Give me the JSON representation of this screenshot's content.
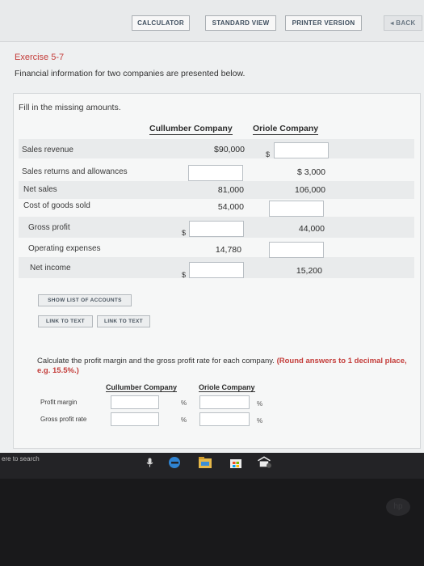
{
  "toolbar": {
    "calculator": "CALCULATOR",
    "standard_view": "STANDARD VIEW",
    "printer_version": "PRINTER VERSION",
    "back": "◂ BACK"
  },
  "exercise": {
    "title": "Exercise 5-7",
    "description": "Financial information for two companies are presented below."
  },
  "table": {
    "instruction": "Fill in the missing amounts.",
    "col1_header": "Cullumber Company",
    "col2_header": "Oriole Company",
    "dollar": "$",
    "rows": [
      {
        "label": "Sales revenue",
        "col1": "$90,000",
        "col2": ""
      },
      {
        "label": "Sales returns and allowances",
        "col1": "",
        "col2": "$ 3,000"
      },
      {
        "label": "Net sales",
        "col1": "81,000",
        "col2": "106,000"
      },
      {
        "label": "Cost of goods sold",
        "col1": "54,000",
        "col2": ""
      },
      {
        "label": "Gross profit",
        "col1": "",
        "col2": "44,000"
      },
      {
        "label": "Operating expenses",
        "col1": "14,780",
        "col2": ""
      },
      {
        "label": "Net income",
        "col1": "",
        "col2": "15,200"
      }
    ]
  },
  "buttons": {
    "show_list": "SHOW LIST OF ACCOUNTS",
    "link1": "LINK TO TEXT",
    "link2": "LINK TO TEXT"
  },
  "ratio": {
    "instruction_plain": "Calculate the profit margin and the gross profit rate for each company. ",
    "instruction_red": "(Round answers to 1 decimal place, e.g. 15.5%.)",
    "col1_header": "Cullumber Company",
    "col2_header": "Oriole Company",
    "percent": "%",
    "rows": [
      {
        "label": "Profit margin"
      },
      {
        "label": "Gross profit rate"
      }
    ]
  },
  "taskbar": {
    "search_text": "ere to search",
    "icons": [
      "microphone-icon",
      "edge-icon",
      "file-explorer-icon",
      "store-icon",
      "network-icon"
    ]
  },
  "colors": {
    "accent_red": "#c43d3a",
    "panel_bg": "#f6f7f7",
    "taskbar_bg": "#232326"
  }
}
